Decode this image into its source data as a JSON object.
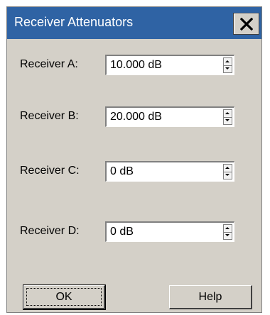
{
  "window": {
    "title": "Receiver Attenuators"
  },
  "receivers": [
    {
      "label": "Receiver A:",
      "value": "10.000 dB"
    },
    {
      "label": "Receiver B:",
      "value": "20.000 dB"
    },
    {
      "label": "Receiver C:",
      "value": "0 dB"
    },
    {
      "label": "Receiver D:",
      "value": "0 dB"
    }
  ],
  "buttons": {
    "ok": "OK",
    "help": "Help"
  },
  "colors": {
    "titlebar": "#2f63a4",
    "dialog": "#d4d0c8"
  },
  "icons": {
    "close": "close-icon"
  }
}
